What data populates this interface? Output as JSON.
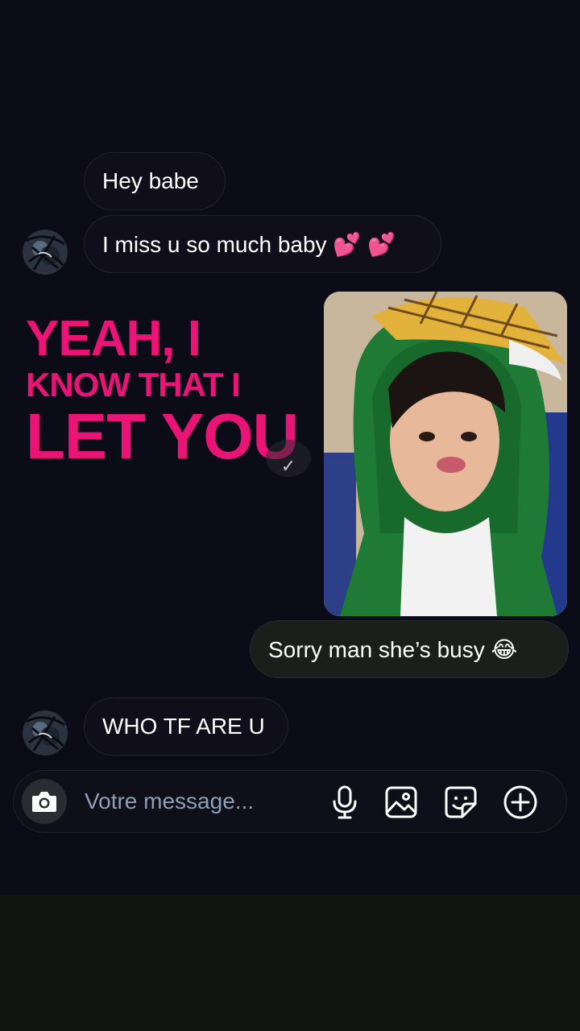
{
  "messages": [
    {
      "text": "Hey babe"
    },
    {
      "text": "I miss u so much baby 💕 💕"
    },
    {
      "text": "Sorry man she’s busy 😂"
    },
    {
      "text": "WHO TF ARE U"
    }
  ],
  "overlay": {
    "line1": "YEAH, I",
    "line2": "KNOW THAT I",
    "line3": "LET YOU",
    "color": "#ea1477"
  },
  "composer": {
    "placeholder": "Votre message...",
    "icons": [
      "camera-icon",
      "microphone-icon",
      "image-icon",
      "sticker-icon",
      "plus-icon"
    ]
  },
  "colors": {
    "background": "#0c0b18",
    "outgoing_bubble": "#1b1f1b",
    "placeholder": "#8f9fb5"
  }
}
